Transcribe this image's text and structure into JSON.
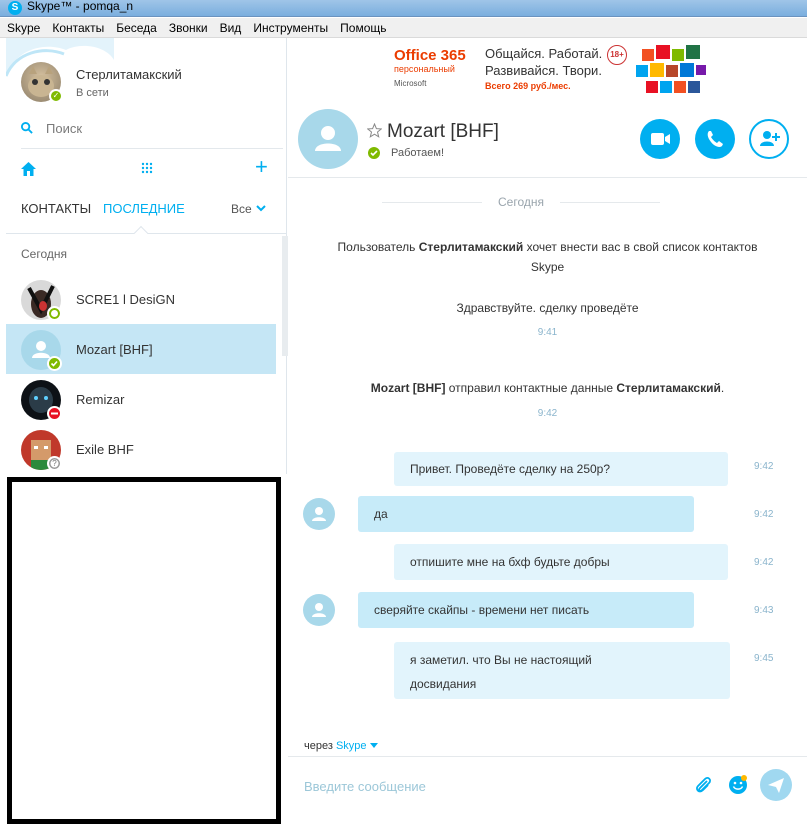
{
  "window": {
    "title": "Skype™ - pomqa_n"
  },
  "menu": [
    "Skype",
    "Контакты",
    "Беседа",
    "Звонки",
    "Вид",
    "Инструменты",
    "Помощь"
  ],
  "profile": {
    "name": "Стерлитамакский",
    "status": "В сети"
  },
  "search": {
    "placeholder": "Поиск"
  },
  "tabs": {
    "contacts": "КОНТАКТЫ",
    "recent": "ПОСЛЕДНИЕ",
    "filter": "Все"
  },
  "section_today": "Сегодня",
  "contacts": [
    {
      "name": "SCRE1 l DesiGN",
      "status": "offline"
    },
    {
      "name": "Mozart [BHF]",
      "status": "online"
    },
    {
      "name": "Remizar",
      "status": "dnd"
    },
    {
      "name": "Exile BHF",
      "status": "unknown"
    }
  ],
  "ad": {
    "brand": "Office 365",
    "sub": "персональный",
    "ms": "Microsoft",
    "line1": "Общайся. Работай.",
    "line2": "Развивайся. Твори.",
    "price": "Всего 269 руб./мес.",
    "age": "18+"
  },
  "chat": {
    "name": "Mozart [BHF]",
    "mood": "Работаем!",
    "date_sep": "Сегодня",
    "sys1_pre": "Пользователь ",
    "sys1_bold": "Стерлитамакский",
    "sys1_post": " хочет внести вас в свой список контактов",
    "sys1_line2": "Skype",
    "sys2": "Здравствуйте. сделку проведёте",
    "sys2_time": "9:41",
    "sys3_bold1": "Mozart [BHF]",
    "sys3_mid": " отправил контактные данные ",
    "sys3_bold2": "Стерлитамакский",
    "sys3_end": ".",
    "sys3_time": "9:42",
    "messages": [
      {
        "dir": "out",
        "text": "Привет. Проведёте сделку на 250р?",
        "time": "9:42"
      },
      {
        "dir": "in",
        "text": "да",
        "time": "9:42"
      },
      {
        "dir": "out",
        "text": "отпишите мне на бхф будьте добры",
        "time": "9:42"
      },
      {
        "dir": "in",
        "text": "сверяйте скайпы - времени нет писать",
        "time": "9:43"
      },
      {
        "dir": "out",
        "text": "я заметил. что Вы не настоящий",
        "text2": "досвидания",
        "time": "9:45"
      }
    ],
    "via_pre": "через ",
    "via_link": "Skype",
    "input_placeholder": "Введите сообщение"
  },
  "colors": {
    "accent": "#00aff0",
    "online": "#7fba00",
    "dnd": "#e81123",
    "selected": "#c5e6f5"
  }
}
